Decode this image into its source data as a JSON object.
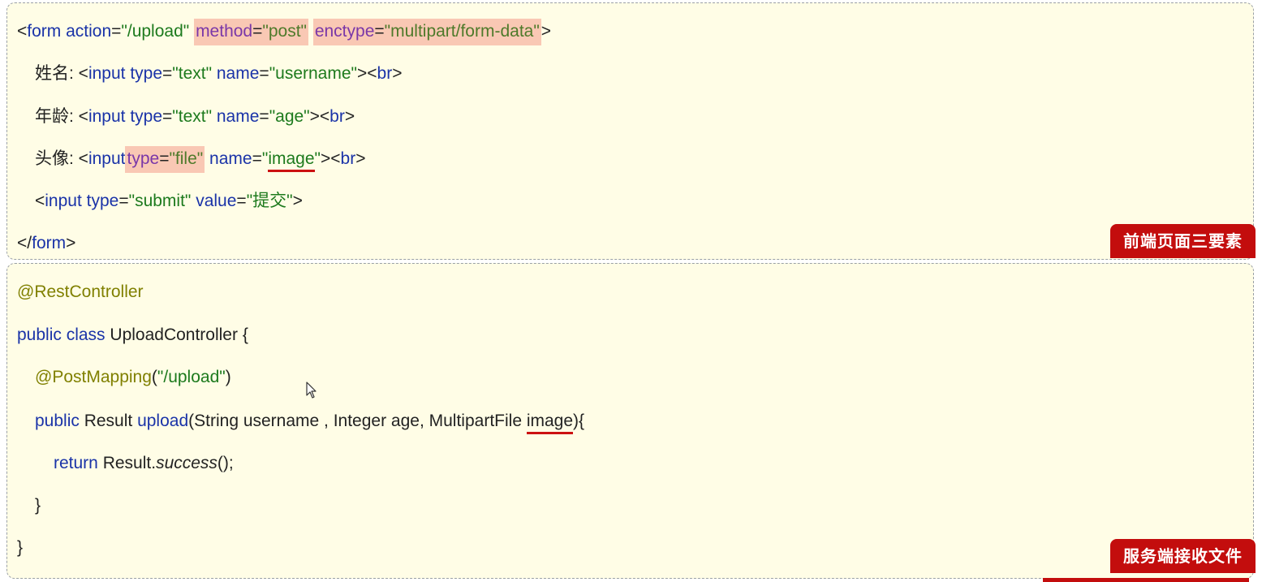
{
  "frontend": {
    "badge": "前端页面三要素",
    "line1": {
      "open": "<",
      "tag": "form",
      "action_attr": " action",
      "action_val": "\"/upload\"",
      "method_attr": "method",
      "method_eq": "=",
      "method_val": "\"post\"",
      "enctype_attr": "enctype",
      "enctype_eq": "=",
      "enctype_val": "\"multipart/form-data\"",
      "close": ">"
    },
    "line2": {
      "label": "姓名: ",
      "open": "<",
      "tag": "input",
      "type_attr": " type",
      "type_val": "\"text\"",
      "name_attr": " name",
      "name_val": "\"username\"",
      "close": "><",
      "br": "br",
      "end": ">"
    },
    "line3": {
      "label": "年龄: ",
      "open": "<",
      "tag": "input",
      "type_attr": " type",
      "type_val": "\"text\"",
      "name_attr": " name",
      "name_val": "\"age\"",
      "close": "><",
      "br": "br",
      "end": ">"
    },
    "line4": {
      "label": "头像: ",
      "open": "<",
      "tag": "input",
      "type_attr": "type",
      "type_eq": "=",
      "type_val": "\"file\"",
      "name_attr": " name",
      "name_q1": "\"",
      "name_val": "image",
      "name_q2": "\"",
      "close": "><",
      "br": "br",
      "end": ">"
    },
    "line5": {
      "open": "<",
      "tag": "input",
      "type_attr": " type",
      "type_val": "\"submit\"",
      "value_attr": " value",
      "value_val": "\"提交\"",
      "end": ">"
    },
    "line6": {
      "open": "</",
      "tag": "form",
      "end": ">"
    }
  },
  "server": {
    "badge": "服务端接收文件",
    "line1": "@RestController",
    "line2": {
      "kw": "public class",
      "rest": " UploadController {"
    },
    "line3": {
      "anno": "@PostMapping",
      "open": "(",
      "val": "\"/upload\"",
      "close": ")"
    },
    "line4": {
      "kw": "public",
      "type": " Result ",
      "fn": "upload",
      "params": "(String username , Integer age, MultipartFile ",
      "param_image": "image",
      "end": "){"
    },
    "line5": {
      "kw": "return",
      "cls": " Result.",
      "method": "success",
      "end": "();"
    },
    "line6": "}",
    "line7": "}"
  },
  "colors": {
    "panel_bg": "#fffde6",
    "badge_bg": "#c30d0d",
    "highlight_bg": "#f9c8b4",
    "underline": "#cc1111"
  }
}
